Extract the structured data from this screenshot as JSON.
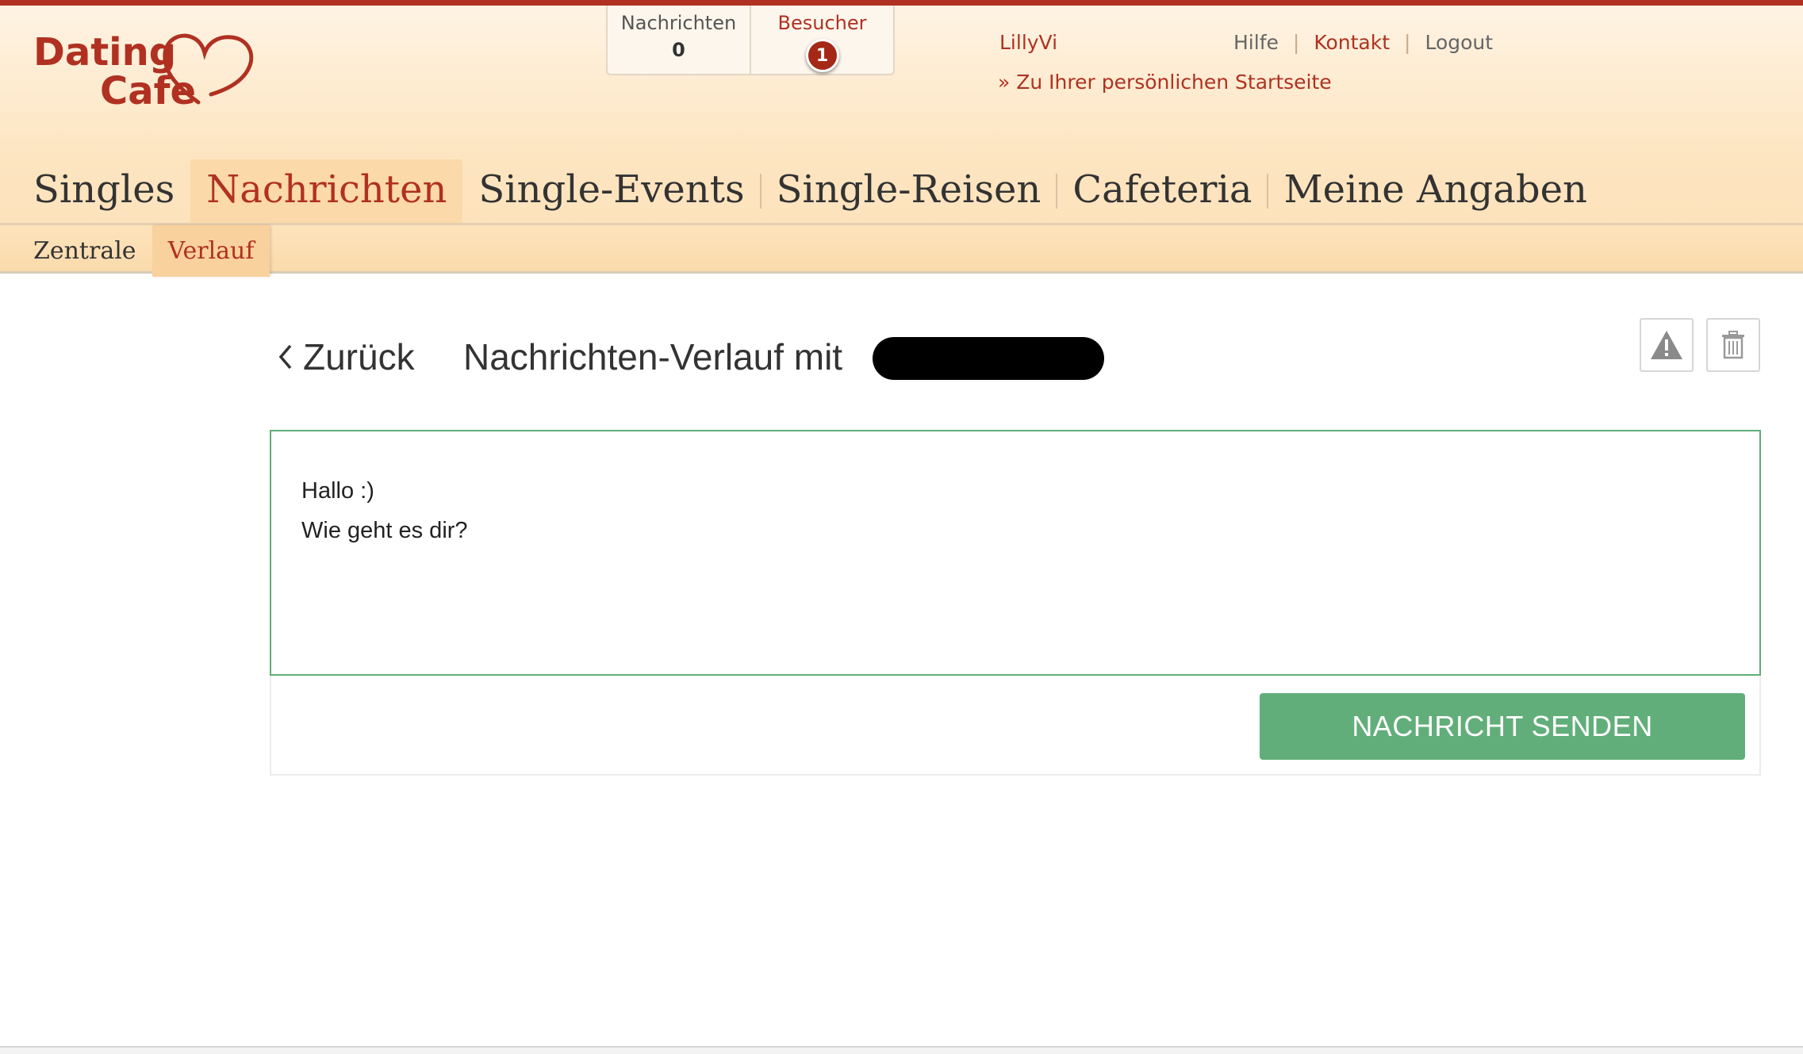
{
  "brand": {
    "line1": "Dating",
    "line2": "Cafe"
  },
  "counters": [
    {
      "label": "Nachrichten",
      "value": "0"
    },
    {
      "label": "Besucher",
      "badge": "1"
    }
  ],
  "header": {
    "username": "LillyVi",
    "startseite_link": "» Zu Ihrer persönlichen Startseite",
    "links": {
      "help": "Hilfe",
      "contact": "Kontakt",
      "logout": "Logout"
    }
  },
  "main_nav": [
    {
      "label": "Singles",
      "active": false
    },
    {
      "label": "Nachrichten",
      "active": true
    },
    {
      "label": "Single-Events",
      "active": false
    },
    {
      "label": "Single-Reisen",
      "active": false
    },
    {
      "label": "Cafeteria",
      "active": false
    },
    {
      "label": "Meine Angaben",
      "active": false
    }
  ],
  "sub_nav": [
    {
      "label": "Zentrale",
      "active": false
    },
    {
      "label": "Verlauf",
      "active": true
    }
  ],
  "conversation": {
    "back_label": "Zurück",
    "title": "Nachrichten-Verlauf mit"
  },
  "compose": {
    "text": "Hallo :)\nWie geht es dir?",
    "send_label": "NACHRICHT SENDEN"
  },
  "icons": {
    "report": "warning-triangle-icon",
    "delete": "trash-icon"
  },
  "colors": {
    "brand_red": "#b03121",
    "accent_green": "#62ae7a",
    "header_bg": "#fde5c1",
    "active_tab": "#fbd9a8"
  }
}
